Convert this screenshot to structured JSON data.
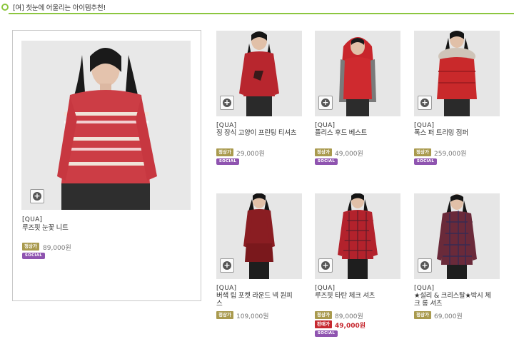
{
  "header": {
    "title": "[여] 첫눈에 어울리는 아이템추천!"
  },
  "colors": {
    "accent": "#8cc63f",
    "regular_tag": "#a99a4e",
    "sale_tag": "#c6282f",
    "social_badge": "#8f54b0"
  },
  "icons": {
    "zoom": "zoom-plus-icon"
  },
  "featured": {
    "brand": "[QUA]",
    "name": "루즈핏 눈꽃 니트",
    "regular_label": "정상가",
    "price": "89,000원",
    "social": "SOCIAL"
  },
  "products": [
    {
      "brand": "[QUA]",
      "name": "징 장식 고양이 프린팅 티셔츠",
      "regular_label": "정상가",
      "price": "29,000원",
      "social": "SOCIAL"
    },
    {
      "brand": "[QUA]",
      "name": "플리스 후드 베스트",
      "regular_label": "정상가",
      "price": "49,000원",
      "social": "SOCIAL"
    },
    {
      "brand": "[QUA]",
      "name": "폭스 퍼 트리밍 점퍼",
      "regular_label": "정상가",
      "price": "259,000원",
      "social": "SOCIAL"
    },
    {
      "brand": "[QUA]",
      "name_line1": "버색 립 포켓 라운드 넥 원피",
      "name_line2": "스",
      "regular_label": "정상가",
      "price": "109,000원"
    },
    {
      "brand": "[QUA]",
      "name": "루즈핏 타탄 체크 셔츠",
      "regular_label": "정상가",
      "price": "89,000원",
      "sale_label": "판매가",
      "sale_price": "49,000원",
      "social": "SOCIAL"
    },
    {
      "brand": "[QUA]",
      "name_line1": "★설리 & 크리스탈★박시 체",
      "name_line2": "크 롱 셔츠",
      "regular_label": "정상가",
      "price": "69,000원"
    }
  ]
}
